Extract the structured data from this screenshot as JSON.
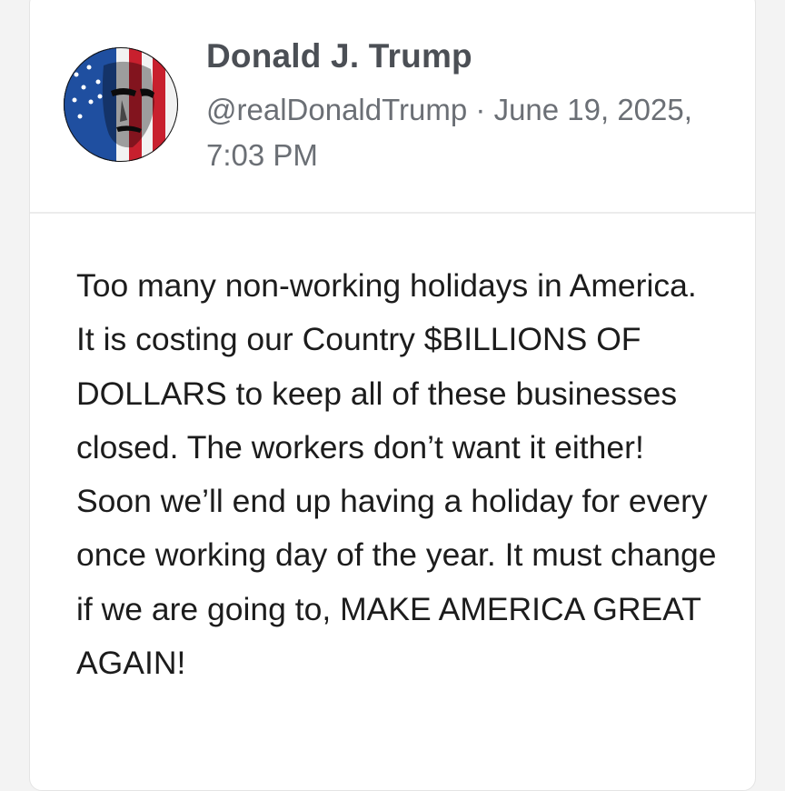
{
  "post": {
    "author_name": "Donald J. Trump",
    "handle": "@realDonaldTrump",
    "separator": " · ",
    "timestamp": "June 19, 2025, 7:03 PM",
    "text": "Too many non-working holidays in America. It is costing our Country $BILLIONS OF DOLLARS to keep all of these businesses closed. The workers don’t want it either! Soon we’ll end up having a holiday for every once working day of the year. It must change if we are going to, MAKE AMERICA GREAT AGAIN!"
  },
  "colors": {
    "name": "#4b4f55",
    "meta": "#6b6f75",
    "body": "#1c1c1c",
    "divider": "#ececec",
    "flag_red": "#c8202e",
    "flag_blue": "#1f4fa0"
  },
  "icons": {
    "avatar": "flag-painted-portrait"
  }
}
